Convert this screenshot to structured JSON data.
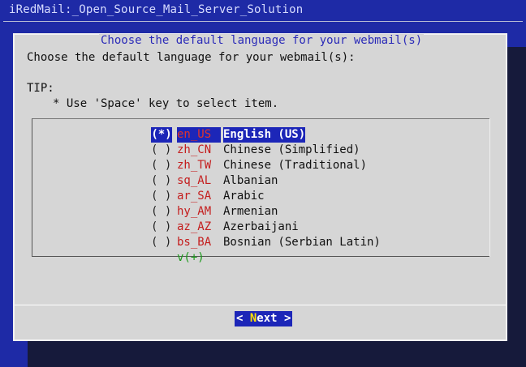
{
  "window": {
    "title": "iRedMail:_Open_Source_Mail_Server_Solution"
  },
  "dialog": {
    "title": "Choose the default language for your webmail(s)",
    "prompt": "Choose the default language for your webmail(s):",
    "tip_heading": "TIP:",
    "tip_text": "* Use 'Space' key to select item.",
    "items": [
      {
        "radio": "(*)",
        "code": "en_US",
        "label": "English (US)",
        "selected": true
      },
      {
        "radio": "( )",
        "code": "zh_CN",
        "label": "Chinese (Simplified)",
        "selected": false
      },
      {
        "radio": "( )",
        "code": "zh_TW",
        "label": "Chinese (Traditional)",
        "selected": false
      },
      {
        "radio": "( )",
        "code": "sq_AL",
        "label": "Albanian",
        "selected": false
      },
      {
        "radio": "( )",
        "code": "ar_SA",
        "label": "Arabic",
        "selected": false
      },
      {
        "radio": "( )",
        "code": "hy_AM",
        "label": "Armenian",
        "selected": false
      },
      {
        "radio": "( )",
        "code": "az_AZ",
        "label": "Azerbaijani",
        "selected": false
      },
      {
        "radio": "( )",
        "code": "bs_BA",
        "label": "Bosnian (Serbian Latin)",
        "selected": false
      }
    ],
    "more_indicator": "v(+)",
    "next_button": {
      "left": "< ",
      "hotkey": "N",
      "rest": "ext",
      "right": " >"
    }
  },
  "colors": {
    "background": "#1e2aa6",
    "dialog": "#d6d6d6",
    "highlight": "#1c26b8",
    "code_text": "#c41d1d",
    "more_indicator": "#1a9a1a",
    "hotkey": "#ffe100"
  }
}
